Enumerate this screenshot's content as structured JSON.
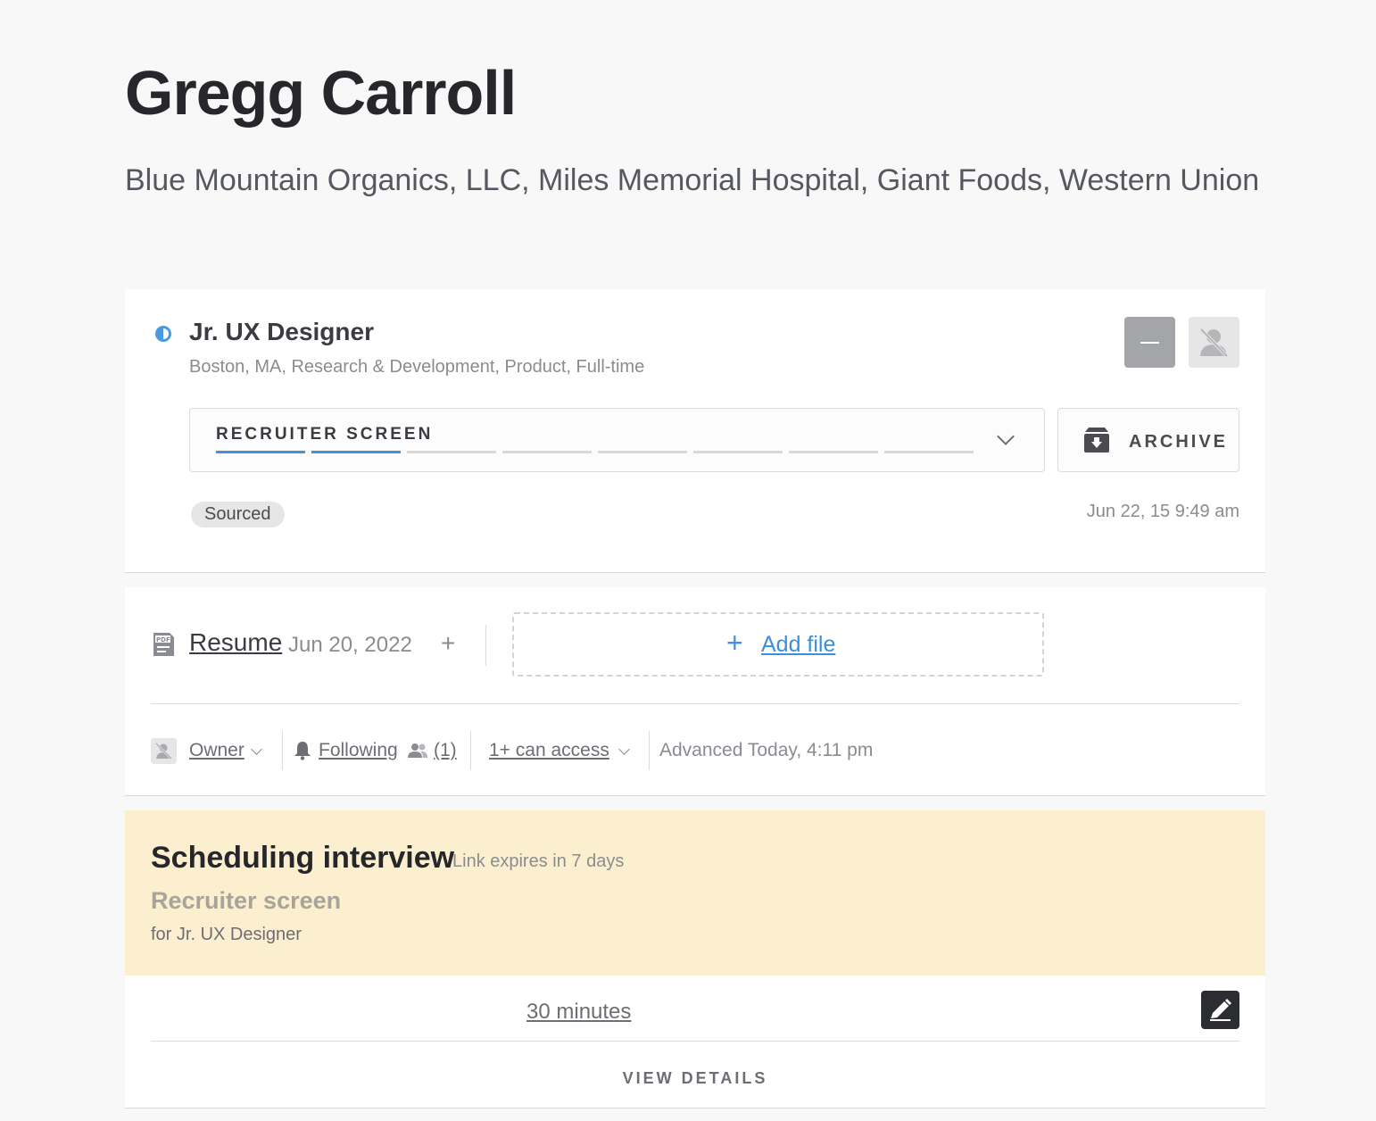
{
  "candidate": {
    "name": "Gregg Carroll",
    "companies": "Blue Mountain Organics, LLC, Miles Memorial Hospital, Giant Foods, Western Union"
  },
  "opportunity": {
    "job_title": "Jr. UX Designer",
    "job_meta": "Boston, MA, Research & Development, Product, Full-time",
    "stage_label": "RECRUITER SCREEN",
    "stage_progress": {
      "completed": 2,
      "total": 8
    },
    "archive_label": "ARCHIVE",
    "tag": "Sourced",
    "timestamp": "Jun 22, 15 9:49 am",
    "colors": {
      "status_dot": "#4a9ae0",
      "stage_active": "#4a8fd9"
    }
  },
  "files": {
    "resume_label": "Resume",
    "resume_date": "Jun 20, 2022",
    "add_file_label": "Add file"
  },
  "meta": {
    "owner_label": "Owner",
    "following_label": "Following",
    "followers_count": "(1)",
    "access_label": "1+ can access",
    "advanced_text": "Advanced Today, 4:11 pm"
  },
  "scheduling": {
    "title": "Scheduling interview",
    "expiry": "Link expires in 7 days",
    "stage": "Recruiter screen",
    "for_job": "for Jr. UX Designer",
    "duration": "30 minutes",
    "view_details": "VIEW DETAILS",
    "colors": {
      "banner": "#fcefd0"
    }
  },
  "icons": [
    "status-dot-icon",
    "minus-icon",
    "user-avatar-icon",
    "chevron-down-icon",
    "archive-box-icon",
    "pdf-icon",
    "plus-icon",
    "bell-icon",
    "users-icon",
    "edit-pencil-icon"
  ]
}
